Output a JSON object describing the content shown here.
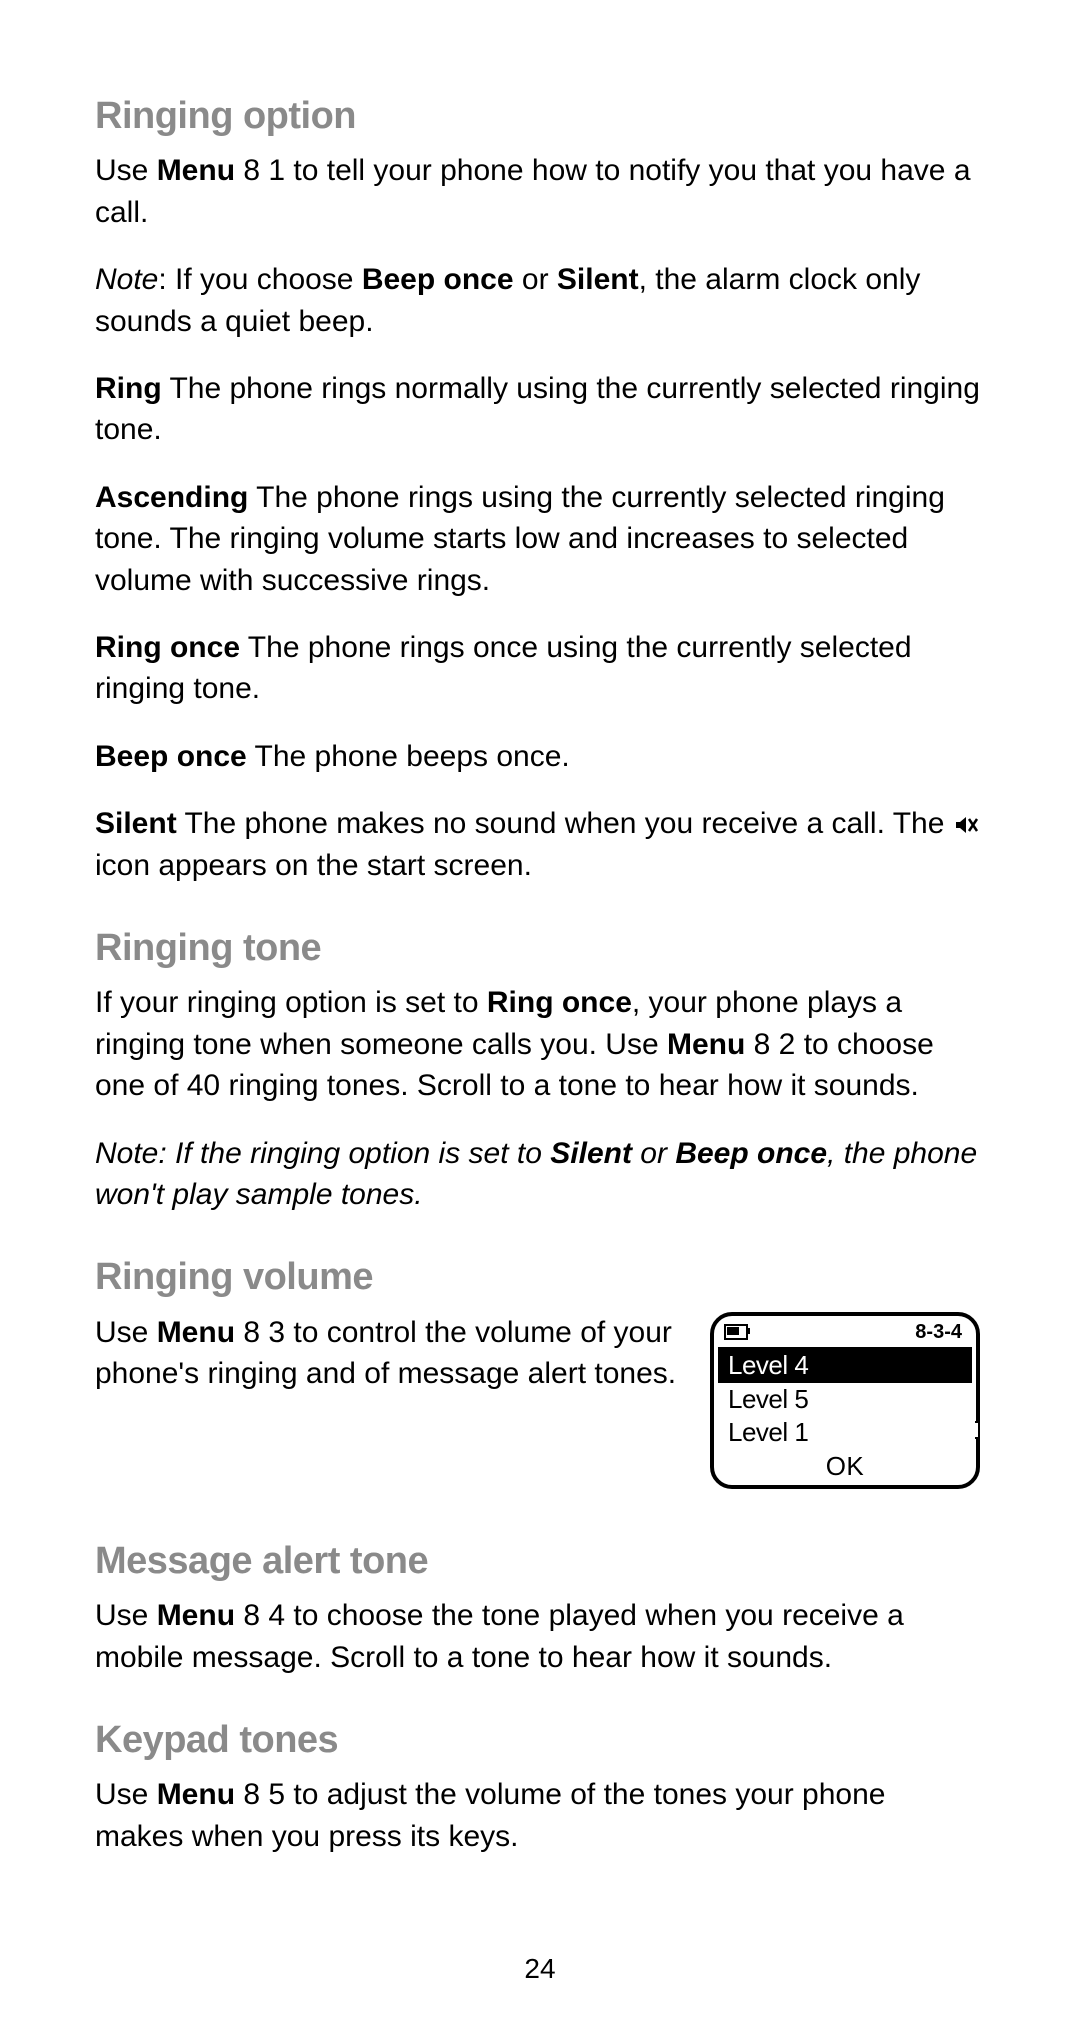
{
  "page_number": "24",
  "sections": {
    "ringing_option": {
      "heading": "Ringing option",
      "intro_a": "Use ",
      "intro_b": "Menu",
      "intro_c": " 8 1 to tell your phone how to notify you that you have a call.",
      "note_a": "Note",
      "note_b": ":  If you choose ",
      "note_c": "Beep once",
      "note_d": " or ",
      "note_e": "Silent",
      "note_f": ", the alarm clock only sounds a quiet beep.",
      "ring_a": "Ring",
      "ring_b": "  The phone rings normally using the currently selected ringing tone.",
      "asc_a": "Ascending",
      "asc_b": "  The phone rings using the currently selected ringing tone. The ringing volume starts low and increases to selected volume with successive rings.",
      "once_a": "Ring once",
      "once_b": "  The phone rings once using the currently selected ringing tone.",
      "beep_a": "Beep once",
      "beep_b": "  The phone beeps once.",
      "silent_a": "Silent",
      "silent_b": "  The phone makes no sound when you receive a call. The ",
      "silent_c": " icon appears on the start screen."
    },
    "ringing_tone": {
      "heading": "Ringing tone",
      "p1_a": "If your ringing option is set to ",
      "p1_b": "Ring once",
      "p1_c": ", your phone plays a ringing tone when someone calls you. Use ",
      "p1_d": "Menu",
      "p1_e": " 8 2 to choose one of 40 ringing tones. Scroll to a tone to hear how it sounds.",
      "note_a": "Note:  If the ringing option is set to ",
      "note_b": "Silent",
      "note_c": " or ",
      "note_d": "Beep once",
      "note_e": ", the phone won't play sample tones."
    },
    "ringing_volume": {
      "heading": "Ringing volume",
      "p_a": "Use ",
      "p_b": "Menu",
      "p_c": " 8 3 to control the volume of your phone's ringing and of message alert tones."
    },
    "message_alert": {
      "heading": "Message alert tone",
      "p_a": "Use ",
      "p_b": "Menu",
      "p_c": " 8 4 to choose the tone played when you receive a mobile message. Scroll to a tone to hear how it sounds."
    },
    "keypad": {
      "heading": "Keypad tones",
      "p_a": "Use ",
      "p_b": "Menu",
      "p_c": " 8 5 to adjust the volume of the tones your phone makes when you press its keys."
    }
  },
  "screen": {
    "menu_path": "8-3-4",
    "rows": [
      "Level 4",
      "Level 5",
      "Level 1"
    ],
    "selected_index": 0,
    "softkey": "OK"
  }
}
